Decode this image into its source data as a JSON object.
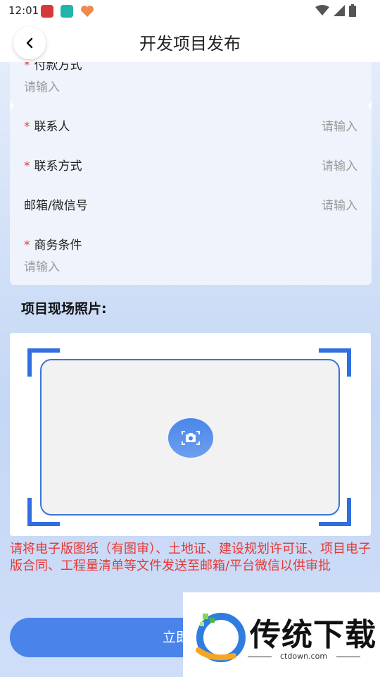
{
  "status_bar": {
    "time": "12:01"
  },
  "header": {
    "title": "开发项目发布"
  },
  "form": {
    "payment": {
      "label": "付款方式",
      "placeholder": "请输入"
    },
    "contact": {
      "label": "联系人",
      "placeholder": "请输入"
    },
    "contact_method": {
      "label": "联系方式",
      "placeholder": "请输入"
    },
    "email_wechat": {
      "label": "邮箱/微信号",
      "placeholder": "请输入"
    },
    "business_terms": {
      "label": "商务条件",
      "placeholder": "请输入"
    },
    "required_mark": "*"
  },
  "photos": {
    "title": "项目现场照片:"
  },
  "notice": "请将电子版图纸（有图审）、土地证、建设规划许可证、项目电子版合同、工程量清单等文件发送至邮箱/平台微信以供审批",
  "submit_label": "立即",
  "watermark": {
    "name": "传统下载",
    "url": "ctdown.com"
  },
  "colors": {
    "accent": "#4a83ea",
    "required": "#e53935",
    "frame": "#2f6fe0"
  }
}
